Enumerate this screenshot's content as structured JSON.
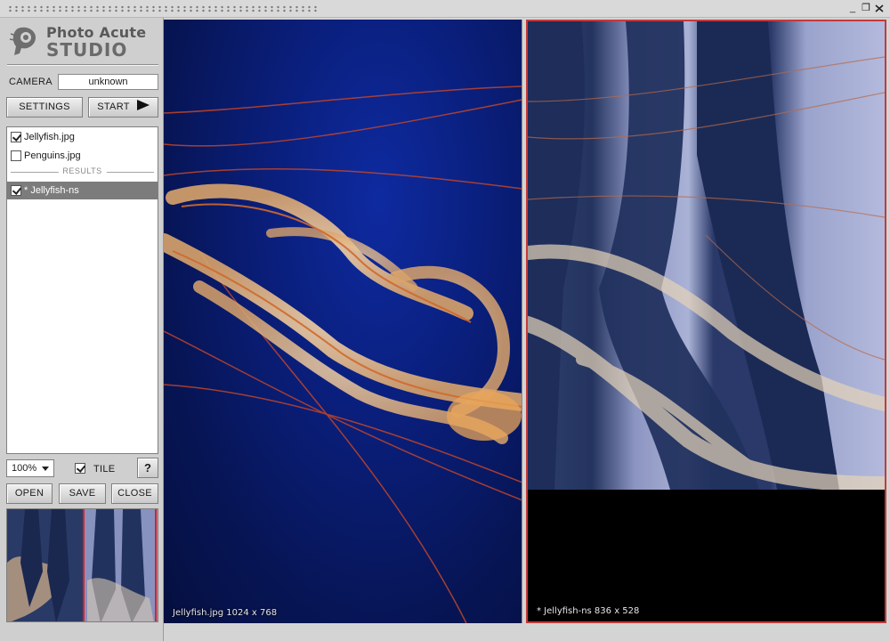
{
  "app": {
    "logo_line1": "Photo Acute",
    "logo_line2": "STUDIO"
  },
  "window_controls": {
    "minimize": "_",
    "restore": "❐"
  },
  "camera": {
    "label": "CAMERA",
    "value": "unknown"
  },
  "buttons": {
    "settings": "SETTINGS",
    "start": "START",
    "open": "OPEN",
    "save": "SAVE",
    "close": "CLOSE",
    "help": "?"
  },
  "files": [
    {
      "name": "Jellyfish.jpg",
      "checked": true
    },
    {
      "name": "Penguins.jpg",
      "checked": false
    }
  ],
  "results_label": "RESULTS",
  "results": [
    {
      "name": "* Jellyfish-ns",
      "checked": true,
      "selected": true
    }
  ],
  "zoom": {
    "value": "100%"
  },
  "tile": {
    "label": "TILE",
    "checked": true
  },
  "viewports": {
    "left_caption": "Jellyfish.jpg  1024 x 768",
    "right_caption": "* Jellyfish-ns  836 x 528"
  },
  "colors": {
    "accent_border": "#c43a3a",
    "selection": "#7c7c7c"
  }
}
